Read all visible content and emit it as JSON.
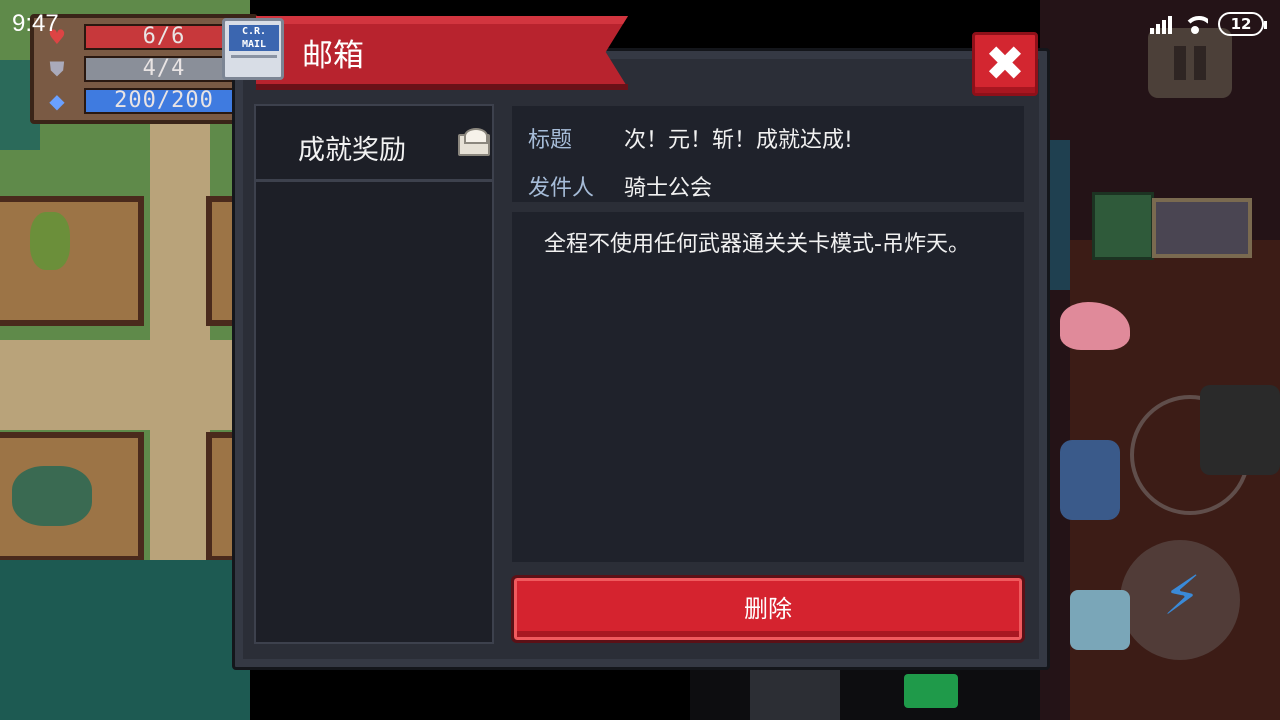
{
  "status_bar": {
    "time": "9:47",
    "battery": "12"
  },
  "hud": {
    "hp": "6/6",
    "armor": "4/4",
    "energy": "200/200"
  },
  "dialog": {
    "title": "邮箱",
    "logo_text": "C.R. MAIL",
    "close_label": "✖",
    "mail_items": [
      {
        "label": "成就奖励",
        "read": true
      }
    ],
    "subject_key": "标题",
    "subject_value": "次！元！斩！成就达成!",
    "sender_key": "发件人",
    "sender_value": "骑士公会",
    "body": "全程不使用任何武器通关关卡模式-吊炸天。",
    "delete_label": "删除"
  },
  "colors": {
    "ribbon": "#b8232e",
    "delete": "#d5232f",
    "panel": "#2b2e37",
    "key_text": "#a6bcd8"
  },
  "icons": {
    "hp": "heart-icon",
    "armor": "shield-icon",
    "energy": "diamond-icon",
    "mail_state": "envelope-open-icon",
    "skill": "lightning-icon"
  }
}
